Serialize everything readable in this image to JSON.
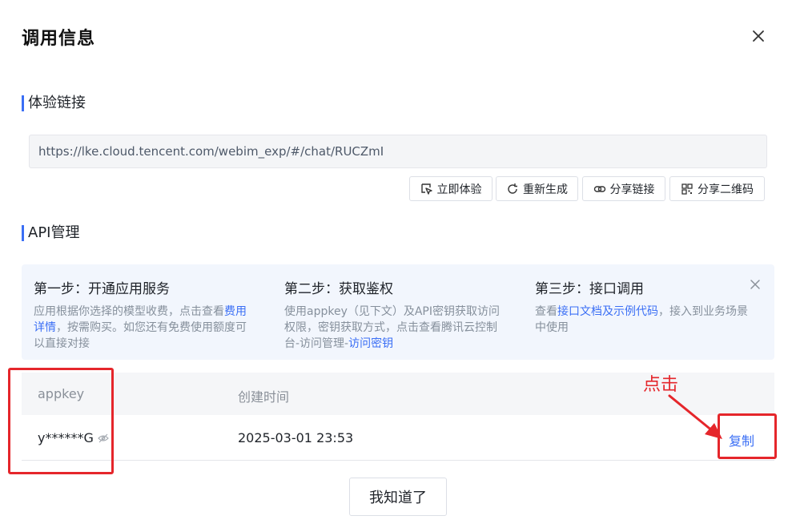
{
  "dialog": {
    "title": "调用信息"
  },
  "experience": {
    "section_title": "体验链接",
    "url": "https://lke.cloud.tencent.com/webim_exp/#/chat/RUCZmI",
    "actions": {
      "try_now": "立即体验",
      "regenerate": "重新生成",
      "share_link": "分享链接",
      "share_qr": "分享二维码"
    }
  },
  "api": {
    "section_title": "API管理",
    "steps": [
      {
        "title": "第一步：开通应用服务",
        "desc_pre": "应用根据你选择的模型收费，点击查看",
        "link": "费用详情",
        "desc_post": "，按需购买。如您还有免费使用额度可以直接对接"
      },
      {
        "title": "第二步：获取鉴权",
        "desc_pre": "使用appkey（见下文）及API密钥获取访问权限，密钥获取方式，点击查看腾讯云控制台-访问管理-",
        "link": "访问密钥",
        "desc_post": ""
      },
      {
        "title": "第三步：接口调用",
        "desc_pre": "查看",
        "link": "接口文档及示例代码",
        "desc_post": "，接入到业务场景中使用"
      }
    ],
    "table": {
      "col_appkey": "appkey",
      "col_created": "创建时间",
      "rows": [
        {
          "appkey": "y******G",
          "created": "2025-03-01 23:53",
          "action": "复制"
        }
      ]
    }
  },
  "footer": {
    "ok_label": "我知道了"
  },
  "annotation": {
    "text": "点击",
    "color": "#e5262b"
  },
  "colors": {
    "accent": "#3b6ff5",
    "steps_bg": "#f2f6fd"
  }
}
